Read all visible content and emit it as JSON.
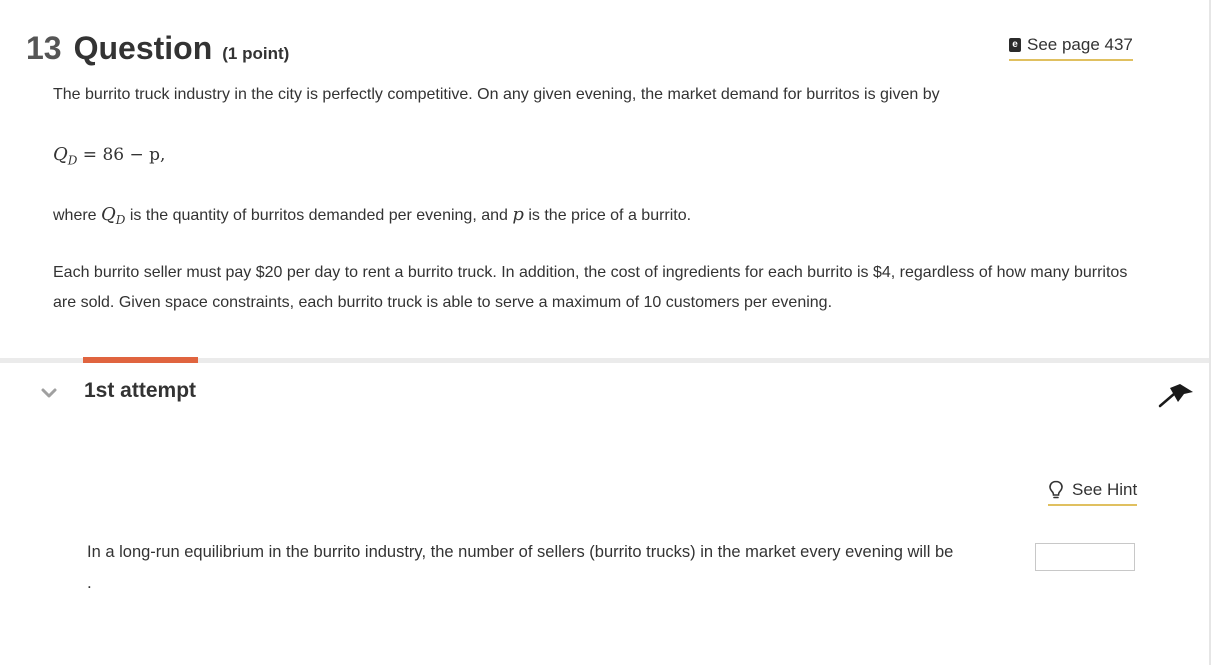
{
  "question": {
    "number": "13",
    "title": "Question",
    "points": "(1 point)",
    "see_page_label": "See page 437",
    "intro": "The burrito truck industry in the city is perfectly competitive. On any given evening, the market demand for burritos is given by",
    "equation": {
      "lhs": "Q",
      "lhs_sub": "D",
      "rhs": "= 86 − p,"
    },
    "where": {
      "pre": "where",
      "var1": "Q",
      "var1_sub": "D",
      "mid": "is the quantity of burritos demanded per evening, and",
      "var2": "p",
      "post": "is the price of a burrito."
    },
    "costs_text": "Each burrito seller must pay $20 per day to rent a burrito truck. In addition, the cost of ingredients for each burrito is $4, regardless of how many burritos are sold. Given space constraints, each burrito truck is able to serve a maximum of 10 customers per evening."
  },
  "attempt": {
    "label": "1st attempt",
    "hint_label": "See Hint",
    "prompt": "In a long-run equilibrium in the burrito industry, the number of sellers (burrito trucks) in the market every evening will be",
    "answer_value": "",
    "trailing": "."
  },
  "colors": {
    "accent_tab": "#e0643f",
    "link_underline": "#e0c060",
    "divider": "#ebebeb"
  },
  "icons": [
    "book-icon",
    "chevron-down-icon",
    "flag-icon",
    "lightbulb-icon"
  ]
}
